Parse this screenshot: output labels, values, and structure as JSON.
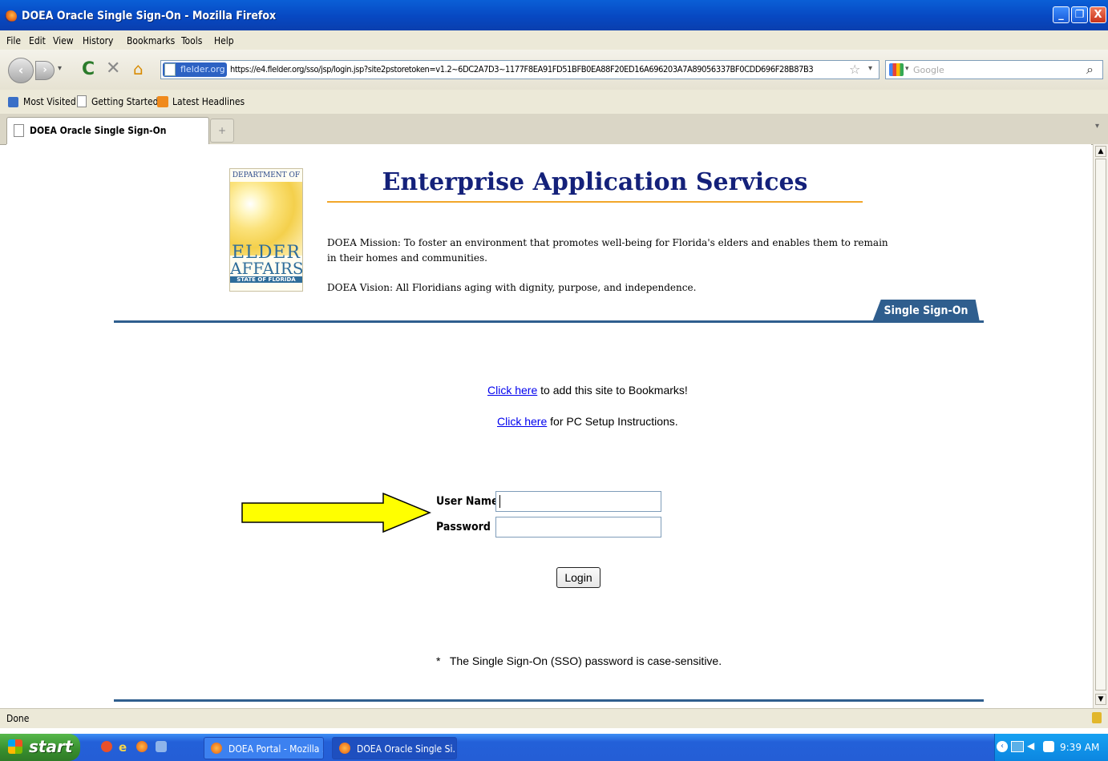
{
  "window": {
    "title": "DOEA Oracle Single Sign-On - Mozilla Firefox",
    "controls": {
      "minimize": "_",
      "restore": "❐",
      "close": "X"
    }
  },
  "menubar": [
    "File",
    "Edit",
    "View",
    "History",
    "Bookmarks",
    "Tools",
    "Help"
  ],
  "navbar": {
    "site_identity": "flelder.org",
    "url": "https://e4.flelder.org/sso/jsp/login.jsp?site2pstoretoken=v1.2~6DC2A7D3~1177F8EA91FD51BFB0EA88F20ED16A696203A7A89056337BF0CDD696F28B87B3",
    "search_placeholder": "Google"
  },
  "bookmarks": [
    "Most Visited",
    "Getting Started",
    "Latest Headlines"
  ],
  "tabs": [
    {
      "label": "DOEA Oracle Single Sign-On"
    }
  ],
  "page": {
    "logo": {
      "top": "DEPARTMENT OF",
      "line1": "ELDER",
      "line2": "AFFAIRS",
      "line3": "STATE OF FLORIDA"
    },
    "heading": "Enterprise Application Services",
    "mission": "DOEA Mission: To foster an environment that promotes well-being for Florida's elders and enables them to remain in their homes and communities.",
    "vision": "DOEA Vision: All Floridians aging with dignity, purpose, and independence.",
    "sso_tab": "Single Sign-On",
    "bookmark_link": "Click here",
    "bookmark_text": " to add this site to Bookmarks!",
    "setup_link": "Click here",
    "setup_text": " for PC Setup Instructions.",
    "username_label": "User Name",
    "password_label": "Password",
    "login_button": "Login",
    "note": "*   The Single Sign-On (SSO) password is case-sensitive."
  },
  "statusbar": {
    "text": "Done"
  },
  "taskbar": {
    "start": "start",
    "tasks": [
      "DOEA Portal - Mozilla ...",
      "DOEA Oracle Single Si..."
    ],
    "clock": "9:39 AM"
  },
  "colors": {
    "heading": "#14217a",
    "rule_blue": "#2f5e8e",
    "rule_orange": "#f2a72a",
    "arrow": "#ffff00"
  }
}
